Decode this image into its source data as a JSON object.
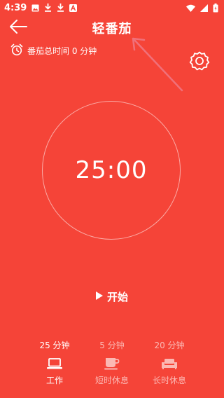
{
  "status_bar": {
    "time": "4:39",
    "left_icons": [
      "image-icon",
      "download-icon",
      "download-icon",
      "app-notification-icon"
    ],
    "right_icons": [
      "wifi-icon",
      "signal-icon",
      "battery-icon"
    ]
  },
  "app_bar": {
    "title": "轻番茄",
    "back_icon": "arrow-left-icon"
  },
  "summary": {
    "total_time_text": "番茄总时间 0 分钟",
    "alarm_icon": "alarm-clock-icon"
  },
  "settings": {
    "icon": "gear-icon"
  },
  "timer": {
    "display": "25:00"
  },
  "start": {
    "label": "开始",
    "icon": "play-icon"
  },
  "modes": [
    {
      "duration": "25 分钟",
      "label": "工作",
      "icon": "laptop-icon",
      "active": true
    },
    {
      "duration": "5 分钟",
      "label": "短时休息",
      "icon": "coffee-cup-icon",
      "active": false
    },
    {
      "duration": "20 分钟",
      "label": "长时休息",
      "icon": "sofa-icon",
      "active": false
    }
  ],
  "colors": {
    "background": "#F54438",
    "foreground": "#FFFFFF",
    "annotation_arrow": "#F0707A"
  }
}
